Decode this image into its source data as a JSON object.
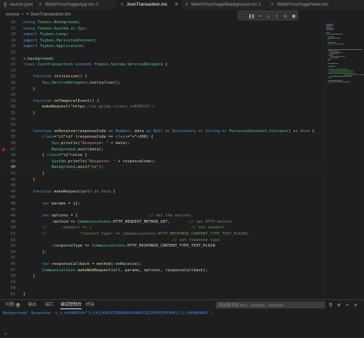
{
  "tabs": [
    {
      "label": "launch.json",
      "icon": "{}",
      "iconColor": "#cbcb41",
      "badge": "",
      "active": false
    },
    {
      "label": "WatchYourSugarApp.mc",
      "icon": "≡",
      "iconColor": "#9d9d9d",
      "badge": "1",
      "active": false
    },
    {
      "label": "JsonTransaction.mc",
      "icon": "≡",
      "iconColor": "#9d9d9d",
      "badge": "",
      "active": true
    },
    {
      "label": "WatchYourSugarBackground.mc",
      "icon": "≡",
      "iconColor": "#9d9d9d",
      "badge": "1",
      "active": false
    },
    {
      "label": "WatchYourSugarView.mc",
      "icon": "≡",
      "iconColor": "#9d9d9d",
      "badge": "",
      "active": false
    }
  ],
  "breadcrumb": {
    "folder": "source",
    "file": "JsonTransaction.mc",
    "sep": ">"
  },
  "debug_toolbar": [
    "⁞",
    "❚❚",
    "↷",
    "↓",
    "↑",
    "↻",
    "■"
  ],
  "line_numbers": [
    "16",
    "17",
    "18",
    "19",
    "20",
    "21",
    "22",
    "23",
    "24",
    "25",
    "26",
    "27",
    "28",
    "29",
    "30",
    "31",
    "32",
    "33",
    "34",
    "35",
    "36",
    "37",
    "38",
    "39",
    "40",
    "41",
    "42",
    "43",
    "44",
    "45",
    "46",
    "47",
    "48",
    "49",
    "50",
    "51",
    "52",
    "53",
    "54",
    "55",
    "56",
    "57",
    "58",
    "59",
    "60",
    "61"
  ],
  "current_line": "40",
  "breakpoint_line": "37",
  "code_lines": [
    "using Toybox.Background;",
    "using Toybox.System as Sys;",
    "import Toybox.Lang;",
    "import Toybox.PersistedContent;",
    "import Toybox.Application;",
    "",
    "(:background)",
    "class JsonTransaction extends Toybox.System.ServiceDelegate {",
    "",
    "    function initialize() {",
    "        Sys.ServiceDelegate.initialize();",
    "    }",
    "",
    "    function onTemporalEvent() {",
    "        makeRequest(\"https://qt.gtimg.cn/q=s_sh600519\");",
    "    }",
    "",
    "",
    "    function onReceive(responseCode as Number, data as Null or Dictionary or String or PersistedContent.Iterator) as Void {",
    "        if (responseCode == 200) {",
    "            Sys.println(\"Response: \" + data);",
    "            Background.exit(data);",
    "        } else {",
    "            System.println(\"Response: \" + responseCode);",
    "            Background.exit(\"no\");",
    "        }",
    "    }",
    "",
    "    function makeRequest(url) as Void {",
    "",
    "        var params = {};",
    "",
    "        var options = {                              // set the options",
    "            :method => Communications.HTTP_REQUEST_METHOD_GET,        // set HTTP method",
    "        //      :headers => {                                          // set headers",
    "        //              \"Content-Type\" => Communications.HTTP_RESPONSE_CONTENT_TYPE_TEXT_PLAIN},",
    "                                                               // set response type",
    "            :responseType => Communications.HTTP_RESPONSE_CONTENT_TYPE_TEXT_PLAIN",
    "        };",
    "",
    "        var responseCallback = method(:onReceive);",
    "        Communications.makeWebRequest(url, params, options, responseCallback);",
    "    }",
    "",
    "",
    "}"
  ],
  "panel": {
    "tabs": [
      {
        "label": "问题",
        "badge": "4",
        "active": false
      },
      {
        "label": "输出",
        "badge": "",
        "active": false
      },
      {
        "label": "端口",
        "badge": "",
        "active": false
      },
      {
        "label": "调试控制台",
        "badge": "",
        "active": true
      },
      {
        "label": "终端",
        "badge": "",
        "active": false
      }
    ],
    "filter_placeholder": "筛选器(例如 text、!exclude、\\escape)",
    "output": "Background: Response: v_s_sh600519=\"1~[3][49C0725B366A4398973225D4570F364][1](10000469)\";",
    "prompt": ">"
  }
}
